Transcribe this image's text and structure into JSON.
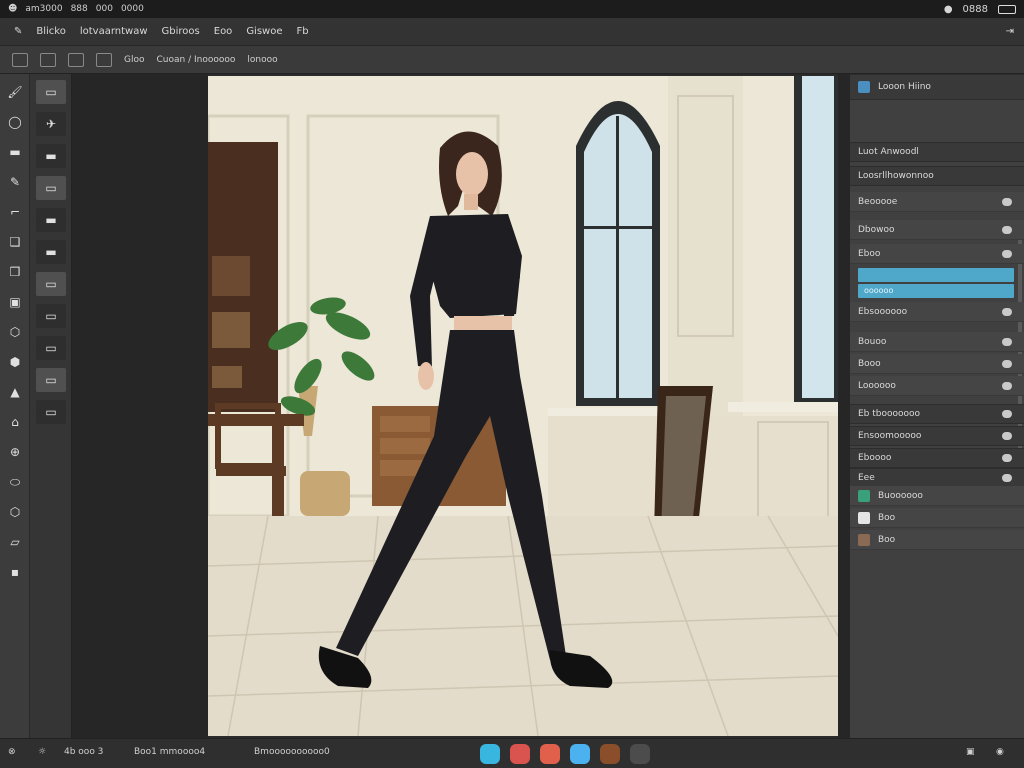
{
  "system_bar": {
    "items": [
      "am3000",
      "888",
      "000",
      "0000"
    ],
    "right_label": "0888"
  },
  "menu_bar": {
    "items": [
      "Blicko",
      "lotvaarntwaw",
      "Gbiroos",
      "Eoo",
      "Giswoe",
      "Fb"
    ]
  },
  "options_bar": {
    "items": [
      "Gloo",
      "Cuoan / Inoooooo",
      "lonooo"
    ]
  },
  "left_tools": {
    "col1": [
      "🖌",
      "◯",
      "▬",
      "✎",
      "⌐",
      "❑",
      "❒",
      "▣",
      "⬡",
      "⬢",
      "▲",
      "⌂",
      "⊕",
      "⬭",
      "⬡",
      "▱",
      "▪"
    ],
    "col2": [
      "▭",
      "✈",
      "▬",
      "▭",
      "▬",
      "▬",
      "▭",
      "▭",
      "▭",
      "▭",
      "▭"
    ]
  },
  "right_panel": {
    "header": "Looon  Hiino",
    "sections": [
      {
        "label": "Luot Anwoodl",
        "type": "head"
      },
      {
        "label": "Loosrllhowonnoo",
        "type": "head"
      },
      {
        "label": "Beooooe",
        "type": "sub"
      },
      {
        "label": "Dbowoo",
        "type": "sub"
      },
      {
        "label": "Eboo",
        "type": "sub"
      },
      {
        "label": "Ebsoooooo",
        "type": "sub"
      },
      {
        "label": "Bouoo",
        "type": "sub"
      },
      {
        "label": "Booo",
        "type": "sub"
      },
      {
        "label": "Loooooo",
        "type": "sub"
      },
      {
        "label": "Eb tbooooooo",
        "type": "head"
      },
      {
        "label": "Ensoomooooo",
        "type": "head"
      },
      {
        "label": "Eboooo",
        "type": "head"
      },
      {
        "label": "Eee",
        "type": "head"
      }
    ],
    "layers": [
      {
        "name": "Buoooooo",
        "thumb": "#3aa07a"
      },
      {
        "name": "Boo",
        "thumb": "#e5e5e5"
      },
      {
        "name": "Boo",
        "thumb": "#8a6a54"
      }
    ],
    "slider_label": "oooooo"
  },
  "bottom_bar": {
    "left_items": [
      "⊗",
      "☼",
      "4b ooo 3",
      "Boo1 mmoooo4",
      "Bmoooooooooo0"
    ],
    "dock_colors": [
      "#39b6df",
      "#d9534f",
      "#e0604c",
      "#4bb1ef",
      "#8a4e2b",
      "#4c4c4c"
    ],
    "right_items": [
      "▣",
      "◉"
    ]
  },
  "canvas": {
    "wall_color": "#ece7d7",
    "floor_color": "#e3dccb",
    "outfit_color": "#1d1d22"
  }
}
